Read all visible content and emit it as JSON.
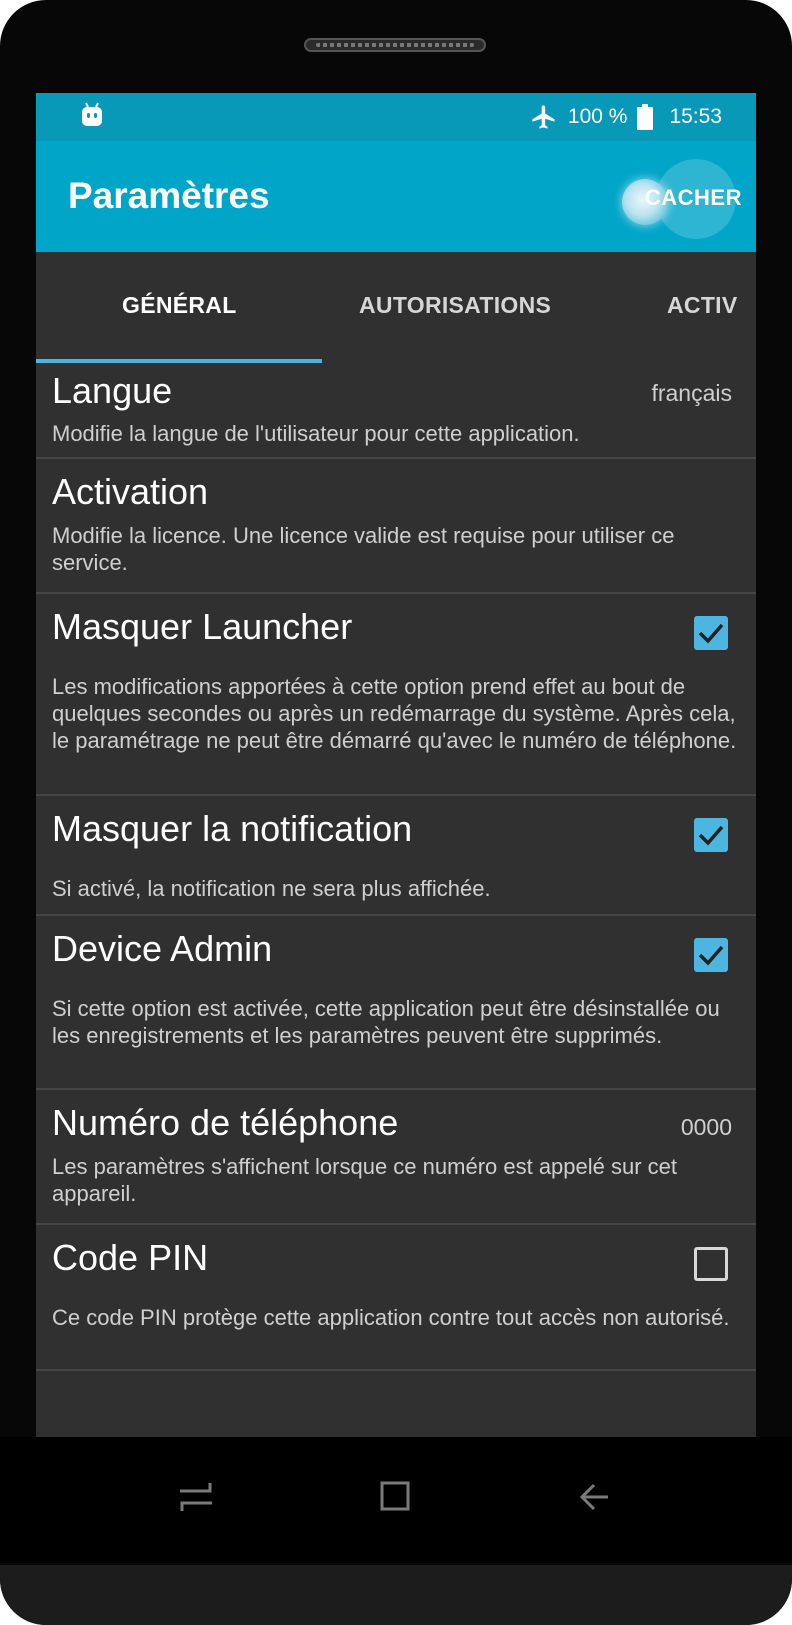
{
  "status_bar": {
    "battery_text": "100 %",
    "time": "15:53",
    "icons": [
      "android-icon",
      "airplane-mode-icon",
      "battery-icon"
    ]
  },
  "app_bar": {
    "title": "Paramètres",
    "action_label": "CACHER",
    "background_color": "#00a5c7",
    "status_color": "#0999b8"
  },
  "tabs": {
    "items": [
      {
        "label": "GÉNÉRAL",
        "active": true
      },
      {
        "label": "AUTORISATIONS",
        "active": false
      },
      {
        "label": "ACTIV",
        "active": false
      }
    ],
    "indicator_color": "#47b5dc"
  },
  "preferences": [
    {
      "title": "Langue",
      "summary": "Modifie la langue de l'utilisateur pour cette application.",
      "value": "français"
    },
    {
      "title": "Activation",
      "summary": "Modifie la licence. Une licence valide est requise pour utiliser ce service."
    },
    {
      "title": "Masquer Launcher",
      "summary": "Les modifications apportées à cette option prend effet au bout de quelques secondes ou après un redémarrage du système. Après cela, le paramétrage ne peut être démarré qu'avec le numéro de téléphone.",
      "checked": true
    },
    {
      "title": "Masquer la notification",
      "summary": "Si activé, la notification ne sera plus affichée.",
      "checked": true
    },
    {
      "title": "Device Admin",
      "summary": "Si cette option est activée, cette application peut être désinstallée ou les enregistrements et les paramètres peuvent être supprimés.",
      "checked": true
    },
    {
      "title": "Numéro de téléphone",
      "summary": "Les paramètres s'affichent lorsque ce numéro est appelé sur cet appareil.",
      "value": "0000"
    },
    {
      "title": "Code PIN",
      "summary": "Ce code PIN protège cette application contre tout accès non autorisé.",
      "checked": false
    }
  ],
  "nav_bar": {
    "icons": [
      "recents-icon",
      "home-icon",
      "back-icon"
    ]
  },
  "colors": {
    "screen_background": "#303030",
    "checkbox_checked": "#4cb6e0",
    "divider": "#454545"
  }
}
